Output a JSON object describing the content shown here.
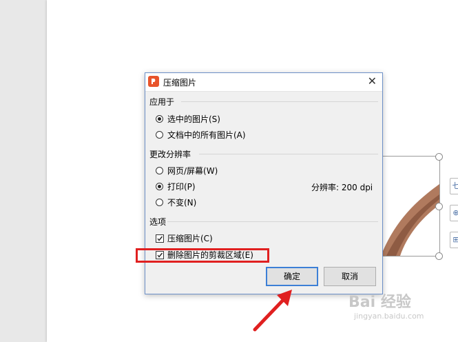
{
  "dialog": {
    "title": "压缩图片",
    "close_glyph": "✕",
    "group_apply": "应用于",
    "opt_selected": "选中的图片(S)",
    "opt_all": "文档中的所有图片(A)",
    "group_resolution": "更改分辨率",
    "opt_web": "网页/屏幕(W)",
    "opt_print": "打印(P)",
    "opt_nochange": "不变(N)",
    "resolution_text": "分辨率:  200 dpi",
    "group_options": "选项",
    "chk_compress": "压缩图片(C)",
    "chk_delete_crop": "删除图片的剪裁区域(E)",
    "ok_label": "确定",
    "cancel_label": "取消"
  },
  "state": {
    "apply_to": "selected",
    "resolution": "print",
    "compress_checked": true,
    "delete_crop_checked": true
  },
  "side_buttons": [
    "七",
    "⊕",
    "⊞"
  ],
  "watermark": {
    "line1": "Bai 经验",
    "line2": "jingyan.baidu.com"
  },
  "colors": {
    "highlight": "#e02020",
    "dialog_border": "#6b8fc7",
    "app_icon": "#e8542b"
  }
}
